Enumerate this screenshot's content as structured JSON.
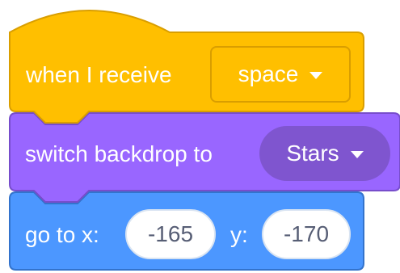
{
  "blocks": {
    "event": {
      "label": "when I receive",
      "dropdown_value": "space",
      "color": "#ffbf00",
      "border_color": "#d99e00"
    },
    "looks": {
      "label": "switch backdrop to",
      "dropdown_value": "Stars",
      "color": "#9966ff",
      "border_color": "#774dcb",
      "dropdown_color": "#7f55cf"
    },
    "motion": {
      "label_x": "go to x:",
      "x_value": "-165",
      "label_y": "y:",
      "y_value": "-170",
      "color": "#4c97ff",
      "border_color": "#3373cc"
    }
  },
  "icons": {
    "dropdown_arrow": "caret-down-icon"
  }
}
